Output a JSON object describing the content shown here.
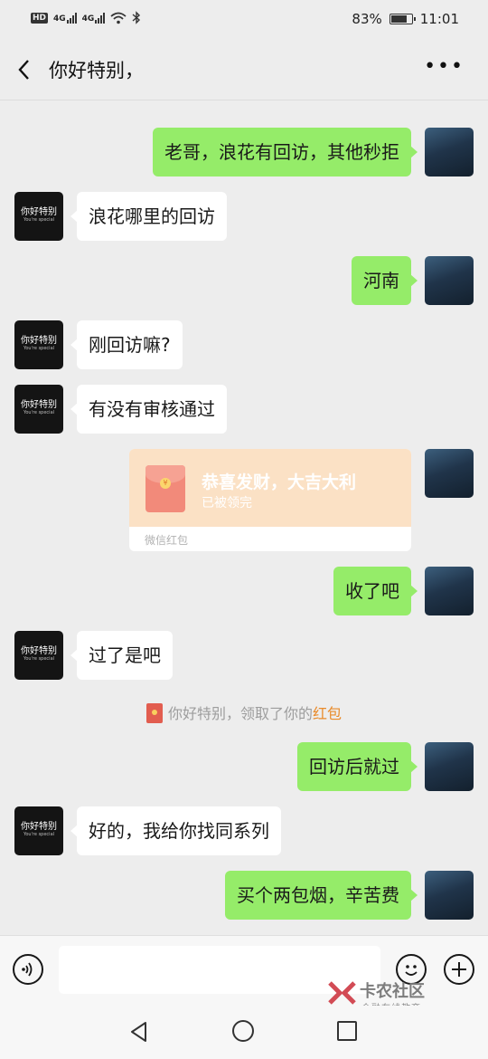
{
  "status_bar": {
    "hd": "HD",
    "net1": "4G",
    "net2": "4G",
    "battery": "83%",
    "battery_level": 0.83,
    "time": "11:01"
  },
  "header": {
    "back_icon": "chevron-left-icon",
    "title": "你好特别，",
    "more_icon": "more-dots-icon"
  },
  "avatars": {
    "contact": {
      "line1": "你好特别",
      "line2": "You're special"
    },
    "self": {
      "icon": "basketball-player-photo"
    }
  },
  "messages": [
    {
      "side": "out",
      "text": "老哥，浪花有回访，其他秒拒"
    },
    {
      "side": "in",
      "text": "浪花哪里的回访"
    },
    {
      "side": "out",
      "text": "河南"
    },
    {
      "side": "in",
      "text": "刚回访嘛?"
    },
    {
      "side": "in",
      "text": "有没有审核通过"
    },
    {
      "side": "out",
      "type": "red_packet",
      "title": "恭喜发财，大吉大利",
      "status": "已被领完",
      "footer": "微信红包"
    },
    {
      "side": "out",
      "text": "收了吧"
    },
    {
      "side": "in",
      "text": "过了是吧"
    },
    {
      "type": "system",
      "prefix": "你好特别，领取了你的",
      "link": "红包"
    },
    {
      "side": "out",
      "text": "回访后就过"
    },
    {
      "side": "in",
      "text": "好的，我给你找同系列"
    },
    {
      "side": "out",
      "text": "买个两包烟，辛苦费"
    }
  ],
  "input_bar": {
    "voice_icon": "voice-icon",
    "emoji_icon": "emoji-icon",
    "plus_icon": "plus-icon",
    "value": ""
  },
  "watermark": {
    "title": "卡农社区",
    "subtitle": "金融在线教育"
  },
  "nav_bar": {
    "back": "nav-back-icon",
    "home": "nav-home-icon",
    "recent": "nav-recent-icon"
  },
  "colors": {
    "out_bubble": "#95ec69",
    "in_bubble": "#ffffff",
    "background": "#ededed",
    "red_packet": "#fbe1c5",
    "link": "#e98b2a"
  }
}
